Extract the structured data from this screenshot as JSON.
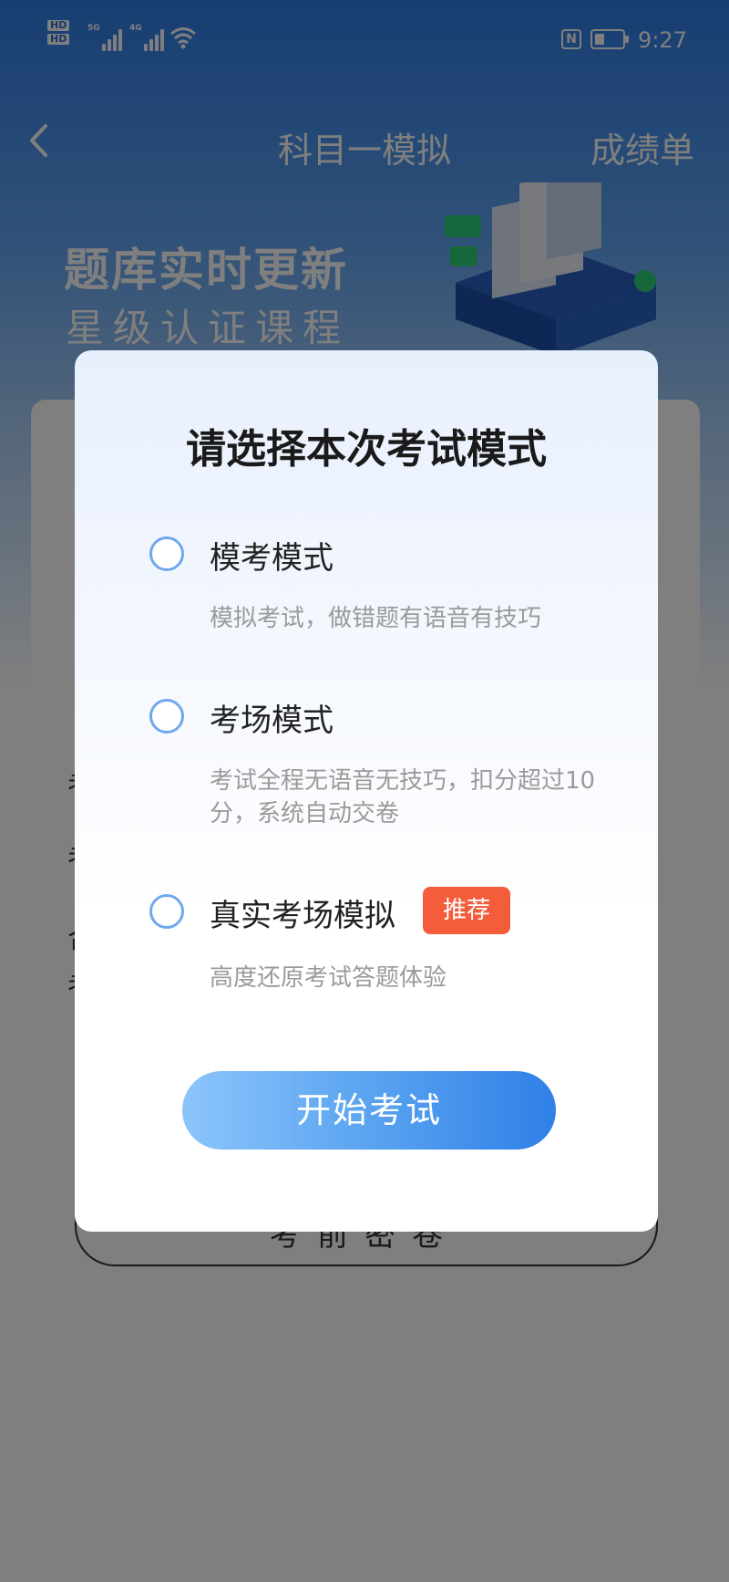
{
  "status_bar": {
    "hd_1": "HD",
    "hd_2": "HD",
    "sig1_label": "5G",
    "sig2_label": "4G",
    "nfc": "N",
    "time": "9:27"
  },
  "navbar": {
    "title": "科目一模拟",
    "right_link": "成绩单"
  },
  "banner": {
    "line1": "题库实时更新",
    "line2": "星级认证课程"
  },
  "background": {
    "lines": [
      "考",
      "考",
      "合",
      "考"
    ],
    "button_text": "考前密卷"
  },
  "modal": {
    "title": "请选择本次考试模式",
    "options": [
      {
        "label": "模考模式",
        "desc": "模拟考试，做错题有语音有技巧",
        "selected": false
      },
      {
        "label": "考场模式",
        "desc": "考试全程无语音无技巧，扣分超过10分，系统自动交卷",
        "selected": false
      },
      {
        "label": "真实考场模拟",
        "desc": "高度还原考试答题体验",
        "selected": false,
        "badge": "推荐"
      }
    ],
    "start_button": "开始考试"
  },
  "colors": {
    "primary_blue": "#2f80e8",
    "radio_border": "#6fa8ec",
    "badge_red": "#f45d3b",
    "overlay": "rgba(0,0,0,0.5)"
  }
}
